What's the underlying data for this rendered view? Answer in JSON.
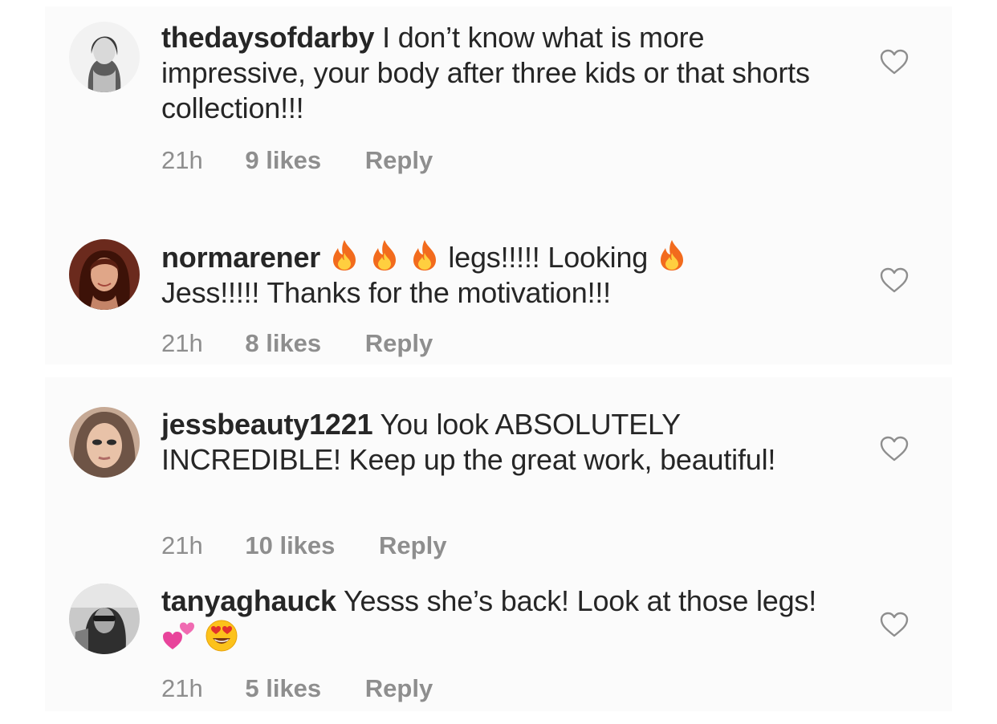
{
  "comments": [
    {
      "username": "thedaysofdarby",
      "text": "I don’t know what is more impressive, your body after three kids or that shorts collection!!!",
      "time": "21h",
      "likes": "9 likes",
      "reply": "Reply"
    },
    {
      "username": "normarener",
      "text_part1": "legs!!!!! Looking",
      "text_part2": "Jess!!!!! Thanks for the motivation!!!",
      "time": "21h",
      "likes": "8 likes",
      "reply": "Reply",
      "emoji": "fire-emoji"
    },
    {
      "username": "jessbeauty1221",
      "text": "You look ABSOLUTELY INCREDIBLE! Keep up the great work, beautiful!",
      "time": "21h",
      "likes": "10 likes",
      "reply": "Reply"
    },
    {
      "username": "tanyaghauck",
      "text": "Yesss she’s back! Look at those legs!",
      "time": "21h",
      "likes": "5 likes",
      "reply": "Reply",
      "emojis": [
        "two-hearts-emoji",
        "heart-eyes-emoji"
      ]
    }
  ],
  "icons": {
    "like": "heart-outline-icon"
  },
  "colors": {
    "text": "#262626",
    "meta": "#8e8e8e",
    "panel": "#fbfbfb"
  }
}
